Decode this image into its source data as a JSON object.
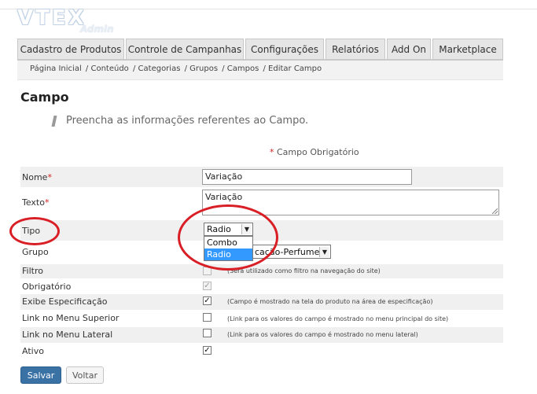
{
  "logo": {
    "main": "VTEX",
    "sub": "Admin"
  },
  "tabs": [
    {
      "label": "Cadastro de Produtos"
    },
    {
      "label": "Controle de Campanhas"
    },
    {
      "label": "Configurações"
    },
    {
      "label": "Relatórios"
    },
    {
      "label": "Add On"
    },
    {
      "label": "Marketplace"
    }
  ],
  "breadcrumb": [
    "Página Inicial",
    "/ Conteúdo",
    "/ Categorias",
    "/ Grupos",
    "/ Campos",
    "/ Editar Campo"
  ],
  "page": {
    "title": "Campo",
    "info": "Preencha as informações referentes ao Campo.",
    "required_note": "Campo Obrigatório",
    "required_mark": "*"
  },
  "form": {
    "nome": {
      "label": "Nome",
      "value": "Variação"
    },
    "texto": {
      "label": "Texto",
      "value": "Variação"
    },
    "tipo": {
      "label": "Tipo",
      "value": "Radio",
      "options": [
        "Combo",
        "Radio"
      ],
      "highlighted": "Radio"
    },
    "grupo": {
      "label": "Grupo",
      "value": "Especificação-Perfumes",
      "visible_value": "cação-Perfumes"
    },
    "filtro": {
      "label": "Filtro",
      "checked": false,
      "help": "(Será utilizado como filtro na navegação do site)"
    },
    "obrigatorio": {
      "label": "Obrigatório",
      "checked": true
    },
    "exibe": {
      "label": "Exibe Especificação",
      "checked": true,
      "help": "(Campo é mostrado na tela do produto na área de especificação)"
    },
    "menu_superior": {
      "label": "Link no Menu Superior",
      "checked": false,
      "help": "(Link para os valores do campo é mostrado no menu principal do site)"
    },
    "menu_lateral": {
      "label": "Link no Menu Lateral",
      "checked": false,
      "help": "(Link para os valores do campo é mostrado no menu lateral)"
    },
    "ativo": {
      "label": "Ativo",
      "checked": true
    }
  },
  "buttons": {
    "save": "Salvar",
    "back": "Voltar"
  },
  "colors": {
    "annotation_red": "#d91f26",
    "primary": "#3b72a6",
    "selection": "#3399ff",
    "required": "#d0211f"
  }
}
